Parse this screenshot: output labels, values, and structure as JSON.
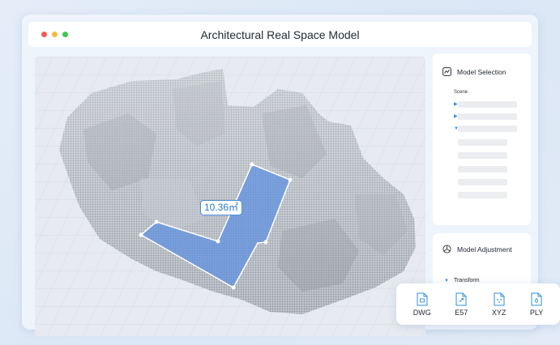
{
  "window": {
    "title": "Architectural Real Space Model",
    "traffic_lights": {
      "close": "#f25c54",
      "minimize": "#f5bd3f",
      "maximize": "#3ec84f"
    }
  },
  "viewport": {
    "measurement": {
      "value": "10.36",
      "unit": "m²",
      "label": "10.36㎡"
    },
    "selection_color": "#5b8fe0"
  },
  "model_selection": {
    "title": "Model Selection",
    "icon": "chart-icon",
    "scene_label": "Scene"
  },
  "model_adjustment": {
    "title": "Model Adjustment",
    "icon": "axis-icon",
    "transform_label": "Transform"
  },
  "export": {
    "formats": [
      {
        "label": "DWG",
        "icon": "dwg-file-icon"
      },
      {
        "label": "E57",
        "icon": "e57-file-icon"
      },
      {
        "label": "XYZ",
        "icon": "xyz-file-icon"
      },
      {
        "label": "PLY",
        "icon": "ply-file-icon"
      }
    ]
  },
  "colors": {
    "accent": "#2f8fe0",
    "text": "#222a36"
  }
}
